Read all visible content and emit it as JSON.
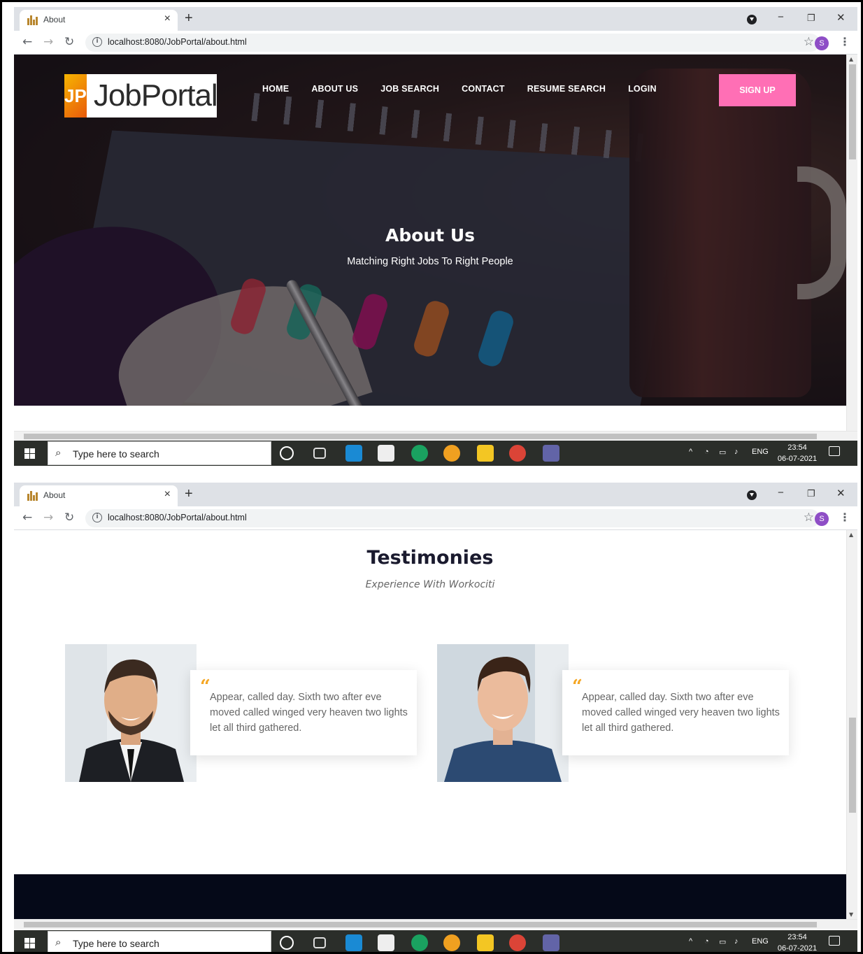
{
  "browser": {
    "tab_title": "About",
    "tab_close": "×",
    "new_tab": "+",
    "url": "localhost:8080/JobPortal/about.html",
    "profile_initial": "S",
    "minimize": "−",
    "restore": "❐",
    "close": "✕"
  },
  "site": {
    "logo_badge": "JP",
    "logo_text": "JobPortal",
    "nav": [
      "HOME",
      "ABOUT US",
      "JOB SEARCH",
      "CONTACT",
      "RESUME SEARCH",
      "LOGIN"
    ],
    "signup": "SIGN UP",
    "hero_title": "About Us",
    "hero_subtitle": "Matching Right Jobs To Right People"
  },
  "testimonials": {
    "title": "Testimonies",
    "subtitle": "Experience With Workociti",
    "items": [
      {
        "quote": "Appear, called day. Sixth two after eve moved called winged very heaven two lights let all third gathered."
      },
      {
        "quote": "Appear, called day. Sixth two after eve moved called winged very heaven two lights let all third gathered."
      }
    ]
  },
  "taskbar": {
    "search_placeholder": "Type here to search",
    "language": "ENG",
    "time": "23:54",
    "date": "06-07-2021"
  },
  "colors": {
    "signup": "#ff6fb5",
    "quote_accent": "#f5a623",
    "footer": "#050918",
    "taskbar": "#2b2e2a"
  }
}
